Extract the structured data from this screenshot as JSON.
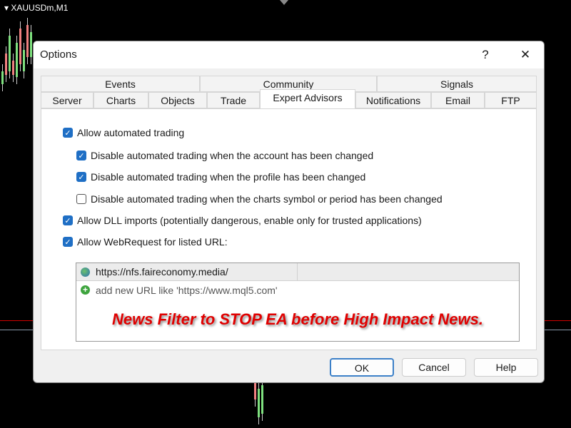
{
  "chart": {
    "symbol": "XAUUSDm,M1",
    "colors": {
      "bull": "#7ee07e",
      "bear": "#f08080",
      "price_line": "#d00000"
    }
  },
  "dialog": {
    "title": "Options",
    "help_icon": "?",
    "close_icon": "✕",
    "tabs_row1": [
      "Events",
      "Community",
      "Signals"
    ],
    "tabs_row2": [
      "Server",
      "Charts",
      "Objects",
      "Trade",
      "Expert Advisors",
      "Notifications",
      "Email",
      "FTP"
    ],
    "active_tab": "Expert Advisors",
    "options": [
      {
        "label": "Allow automated trading",
        "checked": true
      },
      {
        "label": "Disable automated trading when the account has been changed",
        "checked": true
      },
      {
        "label": "Disable automated trading when the profile has been changed",
        "checked": true
      },
      {
        "label": "Disable automated trading when the charts symbol or period has been changed",
        "checked": false
      },
      {
        "label": "Allow DLL imports (potentially dangerous, enable only for trusted applications)",
        "checked": true
      },
      {
        "label": "Allow WebRequest for listed URL:",
        "checked": true
      }
    ],
    "urls": [
      "https://nfs.faireconomy.media/"
    ],
    "add_url_placeholder": "add new URL like 'https://www.mql5.com'",
    "overlay_text": "News Filter to STOP EA before High Impact News.",
    "buttons": {
      "ok": "OK",
      "cancel": "Cancel",
      "help": "Help"
    }
  }
}
